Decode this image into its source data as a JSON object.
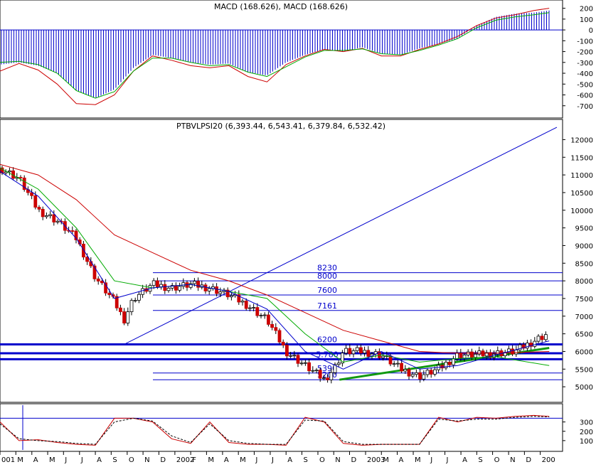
{
  "panels": {
    "macd": {
      "title": "MACD (168.626), MACD (168.626)"
    },
    "price": {
      "title": "PTBVLPSI20 (6,393.44, 6,543.41, 6,379.84, 6,532.42)"
    },
    "osc": {
      "title": ""
    }
  },
  "colors": {
    "blue": "#0000cc",
    "red": "#cc0000",
    "green": "#00aa00",
    "magenta": "#cc00cc",
    "trend_green": "#119911",
    "axis": "#000000",
    "grid": "#c0c0c0"
  },
  "chart_data": [
    {
      "id": "macd",
      "type": "bar",
      "title": "MACD (168.626), MACD (168.626)",
      "ylim": [
        -800,
        250
      ],
      "y_ticks": [
        "200",
        "100",
        "0",
        "-100",
        "-200",
        "-300",
        "-400",
        "-500",
        "-600",
        "-700"
      ],
      "zero_line": 0,
      "series": [
        {
          "name": "",
          "kind": "histogram",
          "x": [
            2001.0,
            2001.1,
            2001.2,
            2001.3,
            2001.4,
            2001.5,
            2001.6,
            2001.7,
            2001.8,
            2001.9,
            2002.0,
            2002.1,
            2002.2,
            2002.3,
            2002.4,
            2002.5,
            2002.6,
            2002.7,
            2002.8,
            2002.9,
            2003.0,
            2003.1,
            2003.2,
            2003.3,
            2003.4,
            2003.5,
            2003.6,
            2003.7,
            2003.8,
            2003.88
          ],
          "values": [
            -320,
            -300,
            -330,
            -400,
            -560,
            -630,
            -550,
            -350,
            -230,
            -260,
            -300,
            -320,
            -310,
            -390,
            -420,
            -300,
            -230,
            -180,
            -200,
            -160,
            -220,
            -230,
            -170,
            -130,
            -80,
            40,
            120,
            150,
            160,
            180
          ]
        },
        {
          "name": "",
          "kind": "line",
          "color_key": "red",
          "x": [
            2001.0,
            2001.1,
            2001.2,
            2001.3,
            2001.4,
            2001.5,
            2001.6,
            2001.7,
            2001.8,
            2001.9,
            2002.0,
            2002.1,
            2002.2,
            2002.3,
            2002.4,
            2002.5,
            2002.6,
            2002.7,
            2002.8,
            2002.9,
            2003.0,
            2003.1,
            2003.2,
            2003.3,
            2003.4,
            2003.5,
            2003.6,
            2003.7,
            2003.8,
            2003.88
          ],
          "values": [
            -380,
            -310,
            -370,
            -500,
            -680,
            -690,
            -600,
            -380,
            -240,
            -280,
            -330,
            -350,
            -330,
            -430,
            -480,
            -320,
            -240,
            -180,
            -200,
            -170,
            -240,
            -240,
            -180,
            -130,
            -60,
            40,
            110,
            140,
            180,
            200
          ]
        },
        {
          "name": "",
          "kind": "line",
          "color_key": "green",
          "x": [
            2001.0,
            2001.1,
            2001.2,
            2001.3,
            2001.4,
            2001.5,
            2001.6,
            2001.7,
            2001.8,
            2001.9,
            2002.0,
            2002.1,
            2002.2,
            2002.3,
            2002.4,
            2002.5,
            2002.6,
            2002.7,
            2002.8,
            2002.9,
            2003.0,
            2003.1,
            2003.2,
            2003.3,
            2003.4,
            2003.5,
            2003.6,
            2003.7,
            2003.8,
            2003.88
          ],
          "values": [
            -300,
            -290,
            -320,
            -400,
            -560,
            -630,
            -570,
            -380,
            -260,
            -260,
            -300,
            -330,
            -320,
            -390,
            -430,
            -340,
            -250,
            -190,
            -190,
            -175,
            -220,
            -230,
            -190,
            -140,
            -80,
            20,
            90,
            120,
            140,
            160
          ]
        }
      ]
    },
    {
      "id": "price",
      "type": "line",
      "title": "PTBVLPSI20 (6,393.44, 6,543.41, 6,379.84, 6,532.42)",
      "ylim": [
        4600,
        12250
      ],
      "y_ticks": [
        "12000",
        "11500",
        "11000",
        "10500",
        "10000",
        "9500",
        "9000",
        "8500",
        "8000",
        "7500",
        "7000",
        "6500",
        "6000",
        "5500",
        "5000"
      ],
      "series": [
        {
          "name": "",
          "kind": "candles",
          "color_key": "red",
          "x": [
            2001.0,
            2001.1,
            2001.2,
            2001.3,
            2001.4,
            2001.5,
            2001.6,
            2001.65,
            2001.7,
            2001.8,
            2001.9,
            2002.0,
            2002.1,
            2002.2,
            2002.3,
            2002.4,
            2002.5,
            2002.6,
            2002.7,
            2002.75,
            2002.8,
            2002.9,
            2003.0,
            2003.1,
            2003.2,
            2003.3,
            2003.4,
            2003.5,
            2003.6,
            2003.7,
            2003.8,
            2003.88
          ],
          "values": [
            11200,
            10900,
            10000,
            9700,
            9200,
            8100,
            7400,
            6900,
            7500,
            7900,
            7800,
            7900,
            7800,
            7600,
            7300,
            6900,
            6000,
            5600,
            5200,
            5500,
            6000,
            6000,
            5900,
            5500,
            5300,
            5500,
            5900,
            5900,
            5950,
            6000,
            6300,
            6532
          ]
        },
        {
          "name": "",
          "kind": "line",
          "color_key": "red",
          "x": [
            2001.0,
            2001.2,
            2001.4,
            2001.6,
            2001.8,
            2002.0,
            2002.2,
            2002.4,
            2002.6,
            2002.8,
            2003.0,
            2003.2,
            2003.4,
            2003.6,
            2003.88
          ],
          "values": [
            11300,
            11000,
            10300,
            9300,
            8800,
            8300,
            8000,
            7600,
            7100,
            6600,
            6300,
            6000,
            5950,
            5950,
            6000
          ]
        },
        {
          "name": "",
          "kind": "line",
          "color_key": "green",
          "x": [
            2001.0,
            2001.2,
            2001.4,
            2001.6,
            2001.8,
            2002.0,
            2002.2,
            2002.4,
            2002.6,
            2002.8,
            2003.0,
            2003.2,
            2003.4,
            2003.6,
            2003.88
          ],
          "values": [
            11200,
            10600,
            9500,
            8000,
            7800,
            7900,
            7700,
            7500,
            6500,
            5700,
            5900,
            5700,
            5800,
            5850,
            5600
          ]
        },
        {
          "name": "",
          "kind": "line",
          "color_key": "blue",
          "x": [
            2001.0,
            2001.2,
            2001.4,
            2001.6,
            2001.8,
            2002.0,
            2002.2,
            2002.4,
            2002.6,
            2002.8,
            2003.0,
            2003.2,
            2003.4,
            2003.6,
            2003.88
          ],
          "values": [
            11100,
            10400,
            9200,
            7500,
            7800,
            7900,
            7700,
            7200,
            6000,
            5500,
            6000,
            5500,
            5600,
            5900,
            6300
          ]
        }
      ],
      "horizontal_levels": [
        {
          "value": 8230,
          "label": "8230"
        },
        {
          "value": 8000,
          "label": "8000"
        },
        {
          "value": 7600,
          "label": "7600"
        },
        {
          "value": 7161,
          "label": "7161"
        },
        {
          "value": 6200,
          "label": "6200",
          "thick": true
        },
        {
          "value": 5950,
          "label": "",
          "thick": true
        },
        {
          "value": 5780,
          "label": "5.780",
          "thick": true
        },
        {
          "value": 5390,
          "label": "5390"
        },
        {
          "value": 5200,
          "label": "5200"
        }
      ],
      "trendlines": [
        {
          "x": [
            2001.65,
            2003.92
          ],
          "values": [
            6200,
            12350
          ],
          "color_key": "blue"
        },
        {
          "x": [
            2002.78,
            2003.88
          ],
          "values": [
            5200,
            6100
          ],
          "color_key": "trend_green"
        }
      ]
    },
    {
      "id": "osc",
      "type": "line",
      "ylim": [
        0,
        480
      ],
      "y_ticks": [
        "300",
        "200",
        "100"
      ],
      "reference_line": 340,
      "series": [
        {
          "name": "",
          "kind": "line",
          "color_key": "red",
          "x": [
            2001.0,
            2001.1,
            2001.2,
            2001.3,
            2001.4,
            2001.5,
            2001.6,
            2001.7,
            2001.8,
            2001.9,
            2002.0,
            2002.1,
            2002.2,
            2002.3,
            2002.4,
            2002.5,
            2002.6,
            2002.7,
            2002.8,
            2002.9,
            2003.0,
            2003.1,
            2003.2,
            2003.3,
            2003.4,
            2003.5,
            2003.6,
            2003.7,
            2003.8,
            2003.88
          ],
          "values": [
            300,
            100,
            110,
            80,
            60,
            50,
            340,
            340,
            300,
            120,
            70,
            300,
            80,
            60,
            60,
            50,
            350,
            300,
            70,
            50,
            60,
            60,
            60,
            350,
            300,
            350,
            340,
            360,
            370,
            360
          ]
        },
        {
          "name": "",
          "kind": "line",
          "dashed": true,
          "color_key": "axis",
          "x": [
            2001.0,
            2001.1,
            2001.2,
            2001.3,
            2001.4,
            2001.5,
            2001.6,
            2001.7,
            2001.8,
            2001.9,
            2002.0,
            2002.1,
            2002.2,
            2002.3,
            2002.4,
            2002.5,
            2002.6,
            2002.7,
            2002.8,
            2002.9,
            2003.0,
            2003.1,
            2003.2,
            2003.3,
            2003.4,
            2003.5,
            2003.6,
            2003.7,
            2003.8,
            2003.88
          ],
          "values": [
            280,
            120,
            100,
            90,
            70,
            60,
            300,
            340,
            310,
            150,
            80,
            280,
            100,
            70,
            60,
            60,
            320,
            310,
            90,
            60,
            60,
            60,
            60,
            330,
            310,
            330,
            330,
            350,
            360,
            355
          ]
        }
      ]
    },
    {
      "id": "xaxis",
      "type": "axis",
      "x_ticks": [
        {
          "x": 2001.0,
          "label": "001"
        },
        {
          "x": 2001.083,
          "label": "M"
        },
        {
          "x": 2001.167,
          "label": "A"
        },
        {
          "x": 2001.25,
          "label": "M"
        },
        {
          "x": 2001.333,
          "label": "J"
        },
        {
          "x": 2001.417,
          "label": "J"
        },
        {
          "x": 2001.5,
          "label": "A"
        },
        {
          "x": 2001.583,
          "label": "S"
        },
        {
          "x": 2001.667,
          "label": "O"
        },
        {
          "x": 2001.75,
          "label": "N"
        },
        {
          "x": 2001.833,
          "label": "D"
        },
        {
          "x": 2001.917,
          "label": "2002"
        },
        {
          "x": 2002.0,
          "label": "F"
        },
        {
          "x": 2002.083,
          "label": "M"
        },
        {
          "x": 2002.167,
          "label": "A"
        },
        {
          "x": 2002.25,
          "label": "M"
        },
        {
          "x": 2002.333,
          "label": "J"
        },
        {
          "x": 2002.417,
          "label": "J"
        },
        {
          "x": 2002.5,
          "label": "A"
        },
        {
          "x": 2002.583,
          "label": "S"
        },
        {
          "x": 2002.667,
          "label": "O"
        },
        {
          "x": 2002.75,
          "label": "N"
        },
        {
          "x": 2002.833,
          "label": "D"
        },
        {
          "x": 2002.917,
          "label": "2003"
        },
        {
          "x": 2003.0,
          "label": "M"
        },
        {
          "x": 2003.083,
          "label": "A"
        },
        {
          "x": 2003.167,
          "label": "M"
        },
        {
          "x": 2003.25,
          "label": "J"
        },
        {
          "x": 2003.333,
          "label": "J"
        },
        {
          "x": 2003.417,
          "label": "A"
        },
        {
          "x": 2003.5,
          "label": "S"
        },
        {
          "x": 2003.583,
          "label": "O"
        },
        {
          "x": 2003.667,
          "label": "N"
        },
        {
          "x": 2003.75,
          "label": "D"
        },
        {
          "x": 2003.833,
          "label": "200"
        }
      ],
      "xlim": [
        2001.0,
        2003.95
      ]
    }
  ]
}
